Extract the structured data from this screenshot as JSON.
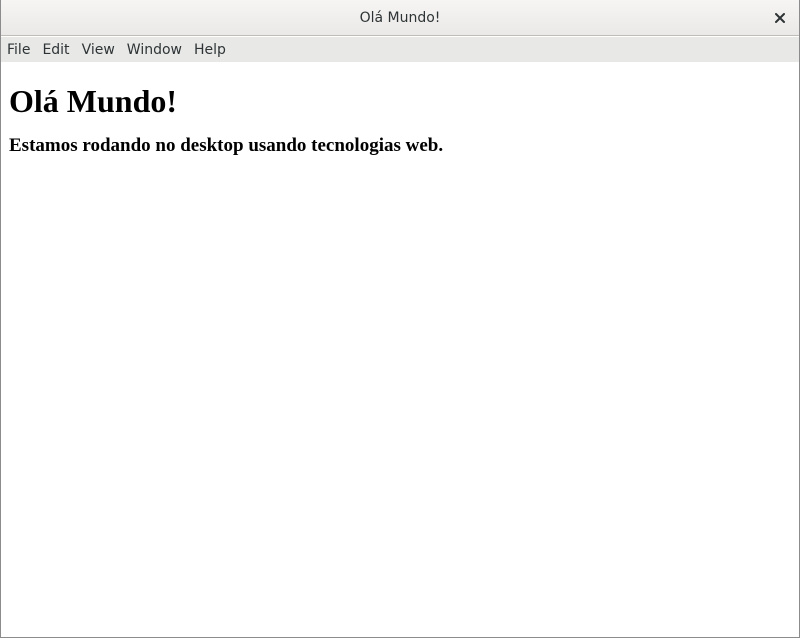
{
  "window": {
    "title": "Olá Mundo!"
  },
  "icons": {
    "close": "close-icon"
  },
  "menubar": {
    "items": [
      {
        "label": "File"
      },
      {
        "label": "Edit"
      },
      {
        "label": "View"
      },
      {
        "label": "Window"
      },
      {
        "label": "Help"
      }
    ]
  },
  "page": {
    "heading": "Olá Mundo!",
    "subheading": "Estamos rodando no desktop usando tecnologias web."
  },
  "colors": {
    "titlebar_bg": "#f6f5f4",
    "menubar_bg": "#e8e8e7",
    "text": "#000000"
  }
}
